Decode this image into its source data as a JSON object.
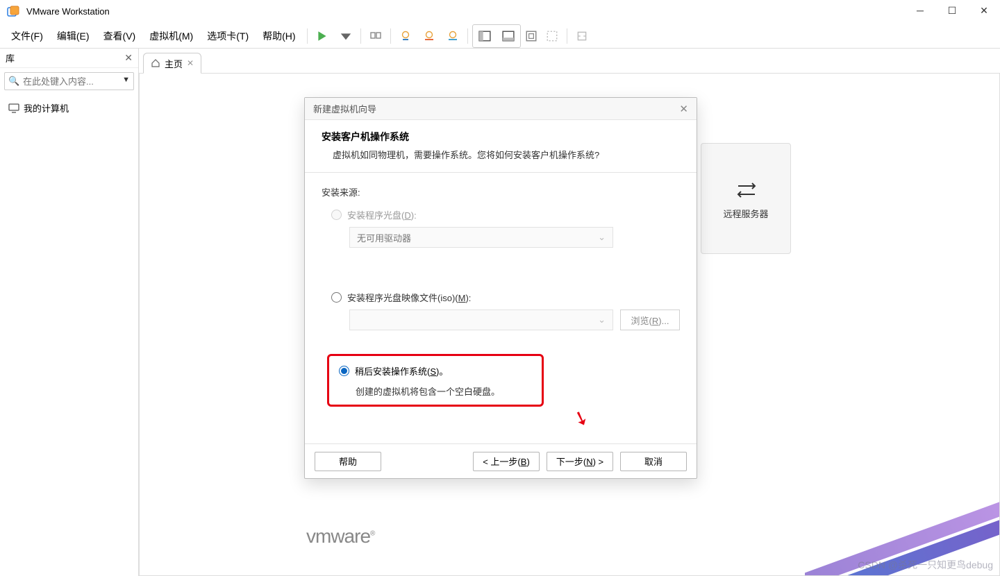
{
  "app": {
    "title": "VMware Workstation"
  },
  "menu": {
    "file": "文件(F)",
    "edit": "编辑(E)",
    "view": "查看(V)",
    "vm": "虚拟机(M)",
    "tabs": "选项卡(T)",
    "help": "帮助(H)"
  },
  "sidebar": {
    "title": "库",
    "search_placeholder": "在此处键入内容...",
    "items": [
      {
        "label": "我的计算机"
      }
    ]
  },
  "tabbar": {
    "home": "主页"
  },
  "homepage": {
    "remote_card": "远程服务器",
    "logo": "vmware"
  },
  "dialog": {
    "title": "新建虚拟机向导",
    "heading": "安装客户机操作系统",
    "subheading": "虚拟机如同物理机，需要操作系统。您将如何安装客户机操作系统?",
    "source_label": "安装来源:",
    "opt_disc": "安装程序光盘(D):",
    "disc_dropdown": "无可用驱动器",
    "opt_iso": "安装程序光盘映像文件(iso)(M):",
    "browse": "浏览(R)...",
    "opt_later": "稍后安装操作系统(S)。",
    "opt_later_note": "创建的虚拟机将包含一个空白硬盘。",
    "btn_help": "帮助",
    "btn_back": "< 上一步(B)",
    "btn_next": "下一步(N) >",
    "btn_cancel": "取消"
  },
  "watermark": "CSDN @杀死一只知更鸟debug"
}
